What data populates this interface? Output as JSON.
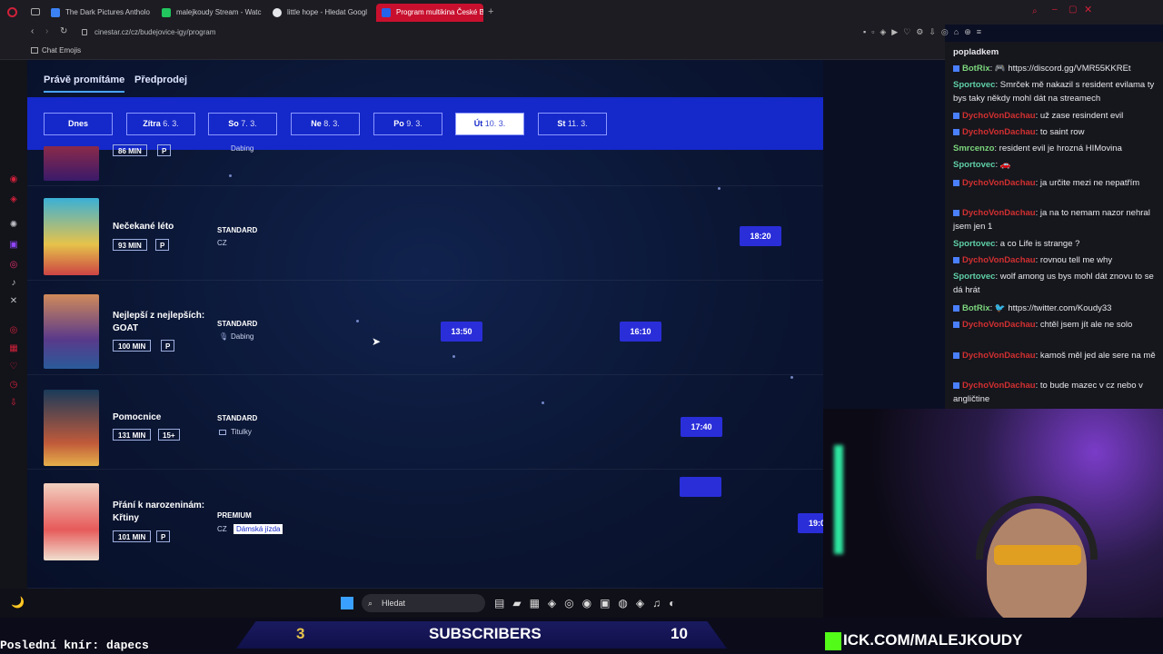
{
  "browser": {
    "tabs": [
      {
        "label": "The Dark Pictures Antholo",
        "color": "#3b82f6"
      },
      {
        "label": "malejkoudy Stream - Watc",
        "color": "#22c55e"
      },
      {
        "label": "little hope - Hledat Googl",
        "color": "#e5e7eb"
      },
      {
        "label": "Program multikina České B",
        "color": "#2563eb"
      }
    ],
    "url": "cinestar.cz/cz/budejovice-igy/program",
    "bookmark": "Chat Emojis"
  },
  "site": {
    "nav": [
      "Právě promítáme",
      "Předprodej"
    ],
    "dates": [
      {
        "day": "Dnes",
        "date": ""
      },
      {
        "day": "Zítra",
        "date": "6. 3."
      },
      {
        "day": "So",
        "date": "7. 3."
      },
      {
        "day": "Ne",
        "date": "8. 3."
      },
      {
        "day": "Po",
        "date": "9. 3."
      },
      {
        "day": "Út",
        "date": "10. 3."
      },
      {
        "day": "St",
        "date": "11. 3."
      }
    ],
    "movies": [
      {
        "title": "",
        "mins": "86 MIN",
        "rating": "P",
        "format": "",
        "sub": "Dabing",
        "times": []
      },
      {
        "title": "Nečekané léto",
        "mins": "93 MIN",
        "rating": "P",
        "format": "STANDARD",
        "sub": "CZ",
        "times": [
          "18:20"
        ]
      },
      {
        "title": "Nejlepší z nejlepších: GOAT",
        "mins": "100 MIN",
        "rating": "P",
        "format": "STANDARD",
        "sub": "Dabing",
        "times": [
          "13:50",
          "16:10"
        ]
      },
      {
        "title": "Pomocnice",
        "mins": "131 MIN",
        "rating": "15+",
        "format": "STANDARD",
        "sub": "Titulky",
        "times": [
          "17:40"
        ]
      },
      {
        "title": "Přání k narozeninám: Křtiny",
        "mins": "101 MIN",
        "rating": "P",
        "format": "PREMIUM",
        "sub": "CZ",
        "tag": "Dámská jízda",
        "times": [
          "19:0"
        ]
      }
    ]
  },
  "chat": {
    "header": "popladkem",
    "messages": [
      {
        "user": "BotRix",
        "color": "#7cd67c",
        "text": ": 🎮 https://discord.gg/VMR55KKREt"
      },
      {
        "user": "Sportovec",
        "color": "#5fd0a5",
        "text": ": Smrček mě nakazil s resident evilama ty bys taky někdy mohl dát na streamech"
      },
      {
        "user": "DychoVonDachau",
        "color": "#d23030",
        "text": ": už zase resindent evil"
      },
      {
        "user": "DychoVonDachau",
        "color": "#d23030",
        "text": ": to saint row"
      },
      {
        "user": "Smrcenzo",
        "color": "#7cd67c",
        "text": ": resident evil je hrozná HIMovina"
      },
      {
        "user": "Sportovec",
        "color": "#5fd0a5",
        "text": ": 🚗"
      },
      {
        "user": "DychoVonDachau",
        "color": "#d23030",
        "text": ": ja určite mezi ne nepatřím"
      },
      {
        "user": "DychoVonDachau",
        "color": "#d23030",
        "text": ": ja na to nemam nazor nehral jsem jen 1"
      },
      {
        "user": "Sportovec",
        "color": "#5fd0a5",
        "text": ": a co Life is strange ?"
      },
      {
        "user": "DychoVonDachau",
        "color": "#d23030",
        "text": ": rovnou tell me why"
      },
      {
        "user": "Sportovec",
        "color": "#5fd0a5",
        "text": ": wolf among us bys mohl dát znovu to se dá hrát"
      },
      {
        "user": "BotRix",
        "color": "#7cd67c",
        "text": ": 🐦 https://twitter.com/Koudy33"
      },
      {
        "user": "DychoVonDachau",
        "color": "#d23030",
        "text": ": chtěl jsem jít ale ne solo"
      },
      {
        "user": "DychoVonDachau",
        "color": "#d23030",
        "text": ": kamoš měl jed ale sere na mě"
      },
      {
        "user": "DychoVonDachau",
        "color": "#d23030",
        "text": ": to bude mazec v cz nebo v angličtine"
      }
    ]
  },
  "taskbar": {
    "search": "Hledat"
  },
  "overlay": {
    "last": "Poslední knír: dapecs",
    "sub_count": "3",
    "sub_label": "SUBSCRIBERS",
    "sub_goal": "10",
    "kick": "ICK.COM/MALEJKOUDY"
  }
}
